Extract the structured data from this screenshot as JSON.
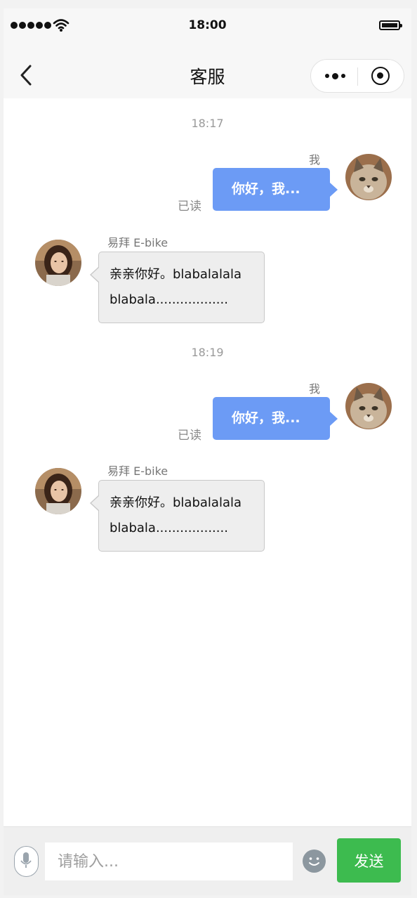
{
  "status_bar": {
    "time": "18:00"
  },
  "nav": {
    "title": "客服"
  },
  "colors": {
    "mine_bubble": "#6c9bf5",
    "send_button": "#3dbb4f",
    "other_bubble": "#eeeeee"
  },
  "messages": [
    {
      "timestamp": "18:17",
      "mine": {
        "sender": "我",
        "text": "你好，我...",
        "read": "已读"
      },
      "other": {
        "sender": "易拜 E-bike",
        "line1": "亲亲你好。blabalalala",
        "line2": "blabala.................."
      }
    },
    {
      "timestamp": "18:19",
      "mine": {
        "sender": "我",
        "text": "你好，我...",
        "read": "已读"
      },
      "other": {
        "sender": "易拜 E-bike",
        "line1": "亲亲你好。blabalalala",
        "line2": "blabala.................."
      }
    }
  ],
  "input_bar": {
    "placeholder": "请输入...",
    "send_label": "发送",
    "voice_icon": "microphone-icon",
    "emoji_icon": "smiley-icon"
  },
  "icons": {
    "back": "chevron-left-icon",
    "more": "more-dots-icon",
    "close": "target-close-icon",
    "wifi": "wifi-icon",
    "battery": "battery-icon",
    "signal": "signal-dots-icon"
  }
}
